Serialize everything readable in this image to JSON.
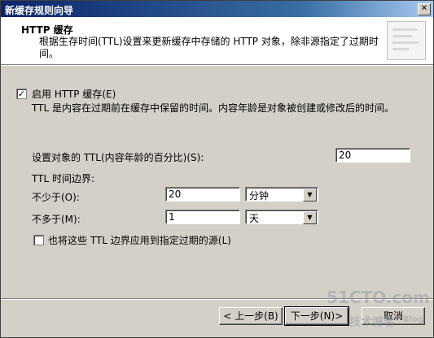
{
  "window": {
    "title": "新缓存规则向导"
  },
  "header": {
    "title": "HTTP 缓存",
    "description": "根据生存时间(TTL)设置来更新缓存中存储的 HTTP 对象，除非源指定了过期时间。"
  },
  "enable_cache": {
    "label": "启用 HTTP 缓存(E)",
    "checked": true,
    "mark": "✓"
  },
  "ttl_note": "TTL 是内容在过期前在缓存中保留的时间。内容年龄是对象被创建或修改后的时间。",
  "ttl_percent": {
    "label": "设置对象的 TTL(内容年龄的百分比)(S):",
    "value": "20"
  },
  "ttl_bounds_label": "TTL 时间边界:",
  "min": {
    "label": "不少于(O):",
    "value": "20",
    "unit": "分钟"
  },
  "max": {
    "label": "不多于(M):",
    "value": "1",
    "unit": "天"
  },
  "apply_bounds": {
    "label": "也将这些 TTL 边界应用到指定过期的源(L)",
    "checked": false
  },
  "buttons": {
    "back": "< 上一步(B)",
    "next": "下一步(N)>",
    "cancel": "取消"
  },
  "watermark": {
    "site": "51CTO.com",
    "sub": "技术博客",
    "blog": "Blog"
  }
}
